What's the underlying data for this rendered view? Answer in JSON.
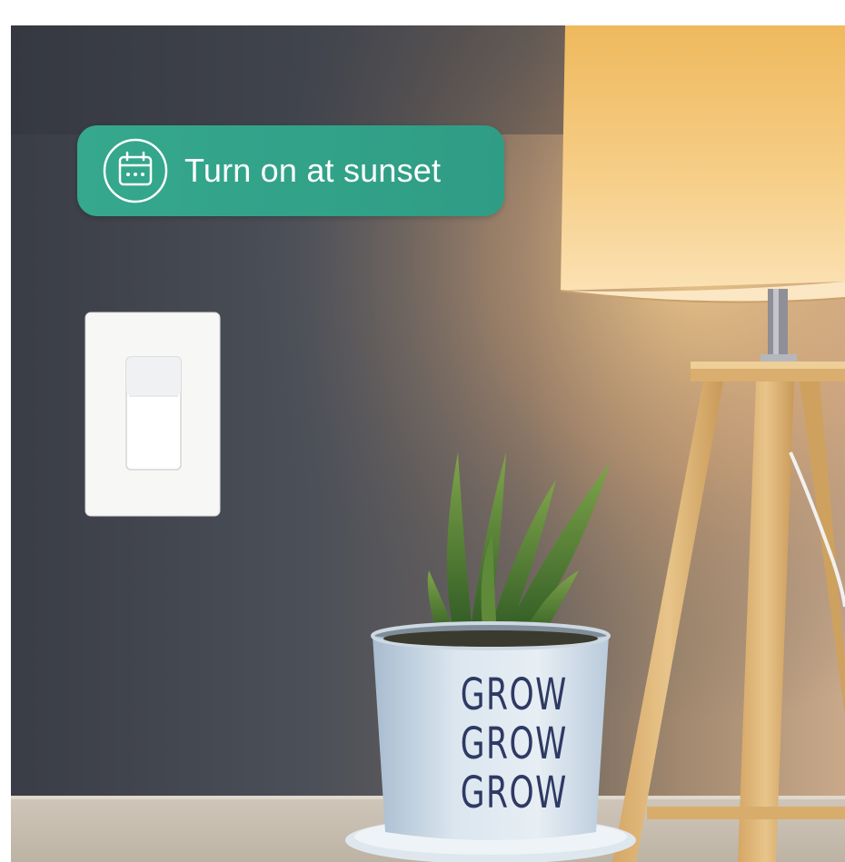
{
  "badge": {
    "label": "Turn on at sunset",
    "icon": "calendar-icon",
    "color": "#33a389"
  },
  "pot": {
    "lines": [
      "GROW",
      "GROW",
      "GROW"
    ],
    "text_color": "#2e3a63"
  },
  "scene": {
    "wall_color": "#4a4d55",
    "lamp_glow": "#f3c37d"
  }
}
